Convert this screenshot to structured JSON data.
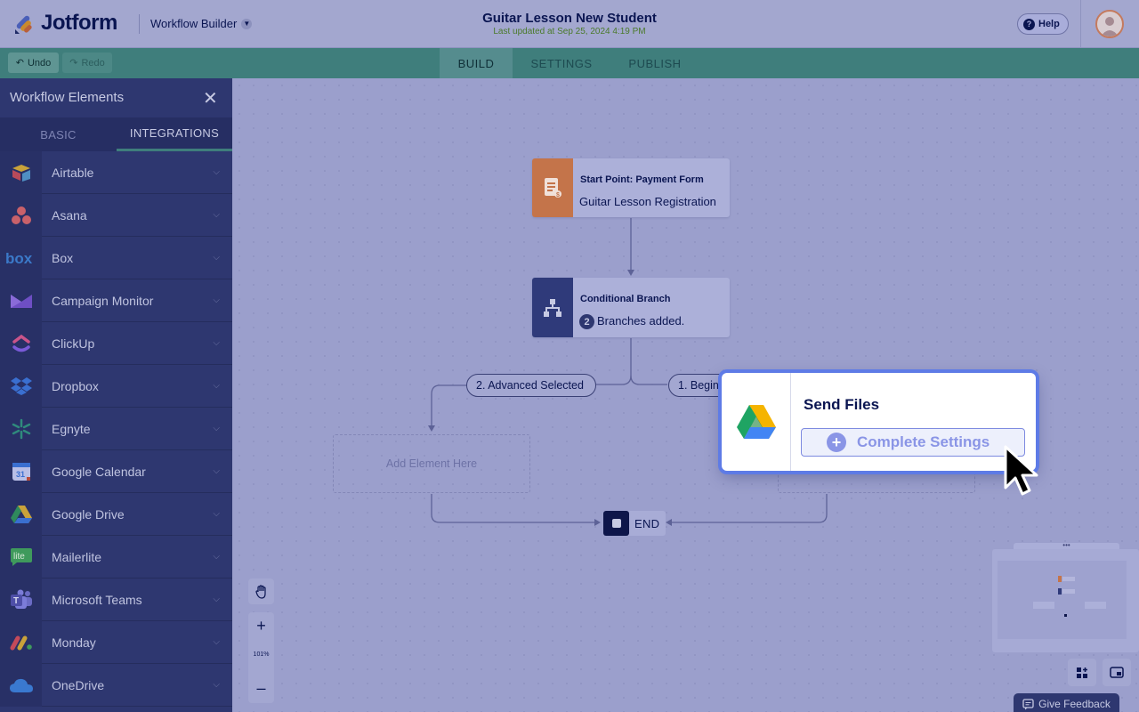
{
  "header": {
    "logo_text": "Jotform",
    "workflow_builder_label": "Workflow Builder",
    "form_title": "Guitar Lesson New Student",
    "last_updated": "Last updated at Sep 25, 2024 4:19 PM",
    "help_label": "Help"
  },
  "toolbar": {
    "undo_label": "Undo",
    "redo_label": "Redo",
    "tabs": [
      {
        "label": "BUILD",
        "active": true
      },
      {
        "label": "SETTINGS",
        "active": false
      },
      {
        "label": "PUBLISH",
        "active": false
      }
    ]
  },
  "sidebar": {
    "title": "Workflow Elements",
    "tabs": [
      {
        "label": "BASIC",
        "active": false
      },
      {
        "label": "INTEGRATIONS",
        "active": true
      }
    ],
    "items": [
      {
        "label": "Airtable",
        "icon": "airtable-icon"
      },
      {
        "label": "Asana",
        "icon": "asana-icon"
      },
      {
        "label": "Box",
        "icon": "box-icon"
      },
      {
        "label": "Campaign Monitor",
        "icon": "campaign-monitor-icon"
      },
      {
        "label": "ClickUp",
        "icon": "clickup-icon"
      },
      {
        "label": "Dropbox",
        "icon": "dropbox-icon"
      },
      {
        "label": "Egnyte",
        "icon": "egnyte-icon"
      },
      {
        "label": "Google Calendar",
        "icon": "google-calendar-icon"
      },
      {
        "label": "Google Drive",
        "icon": "google-drive-icon"
      },
      {
        "label": "Mailerlite",
        "icon": "mailerlite-icon"
      },
      {
        "label": "Microsoft Teams",
        "icon": "microsoft-teams-icon"
      },
      {
        "label": "Monday",
        "icon": "monday-icon"
      },
      {
        "label": "OneDrive",
        "icon": "onedrive-icon"
      }
    ]
  },
  "canvas": {
    "start_node": {
      "kicker": "Start Point: Payment Form",
      "text": "Guitar Lesson Registration"
    },
    "branch_node": {
      "kicker": "Conditional Branch",
      "count": "2",
      "text": "Branches added."
    },
    "branch_left_label": "2. Advanced Selected",
    "branch_right_label": "1. Beginner Selected",
    "add_element_label": "Add Element Here",
    "end_label": "END",
    "zoom_level": "101%"
  },
  "send_files_card": {
    "title": "Send Files",
    "button_label": "Complete Settings",
    "icon": "google-drive-icon"
  },
  "feedback_label": "Give Feedback",
  "colors": {
    "brand_navy": "#0a1551",
    "accent_teal": "#3f7e7c",
    "start_node_orange": "#c4744a",
    "branch_node_blue": "#2f3a7a",
    "card_accent": "#5e7be6"
  }
}
